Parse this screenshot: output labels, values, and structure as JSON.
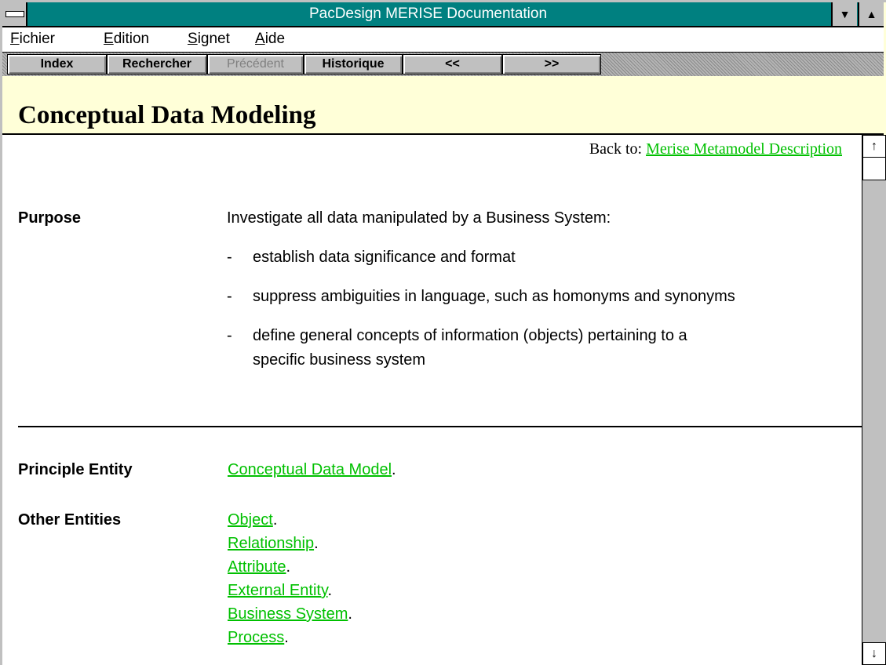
{
  "window": {
    "title": "PacDesign MERISE Documentation",
    "minimize_glyph": "▼",
    "maximize_glyph": "▲"
  },
  "menu": {
    "items": [
      {
        "accel": "F",
        "rest": "ichier"
      },
      {
        "accel": "E",
        "rest": "dition"
      },
      {
        "accel": "S",
        "rest": "ignet"
      },
      {
        "accel": "A",
        "rest": "ide"
      }
    ]
  },
  "toolbar": {
    "index": "Index",
    "search": "Rechercher",
    "previous": "Précédent",
    "history": "Historique",
    "back": "<<",
    "forward": ">>"
  },
  "page": {
    "heading": "Conceptual Data Modeling",
    "back_to_label": "Back to: ",
    "back_to_link": "Merise Metamodel Description",
    "purpose_label": "Purpose",
    "purpose_intro": "Investigate all data manipulated by a Business System:",
    "purpose_points": [
      "establish data significance and format",
      "suppress ambiguities in language, such as homonyms and synonyms",
      "define general concepts of information (objects) pertaining to a",
      "specific business system"
    ],
    "dash": "-",
    "principle_label": "Principle Entity",
    "principle_link": "Conceptual Data Model",
    "other_label": "Other Entities",
    "other_links": [
      "Object",
      "Relationship",
      "Attribute",
      "External Entity",
      "Business System",
      "Process"
    ],
    "period": "."
  },
  "scrollbar": {
    "up_glyph": "↑",
    "down_glyph": "↓"
  },
  "colors": {
    "titlebar": "#008080",
    "link": "#00c000",
    "band": "#ffffd8"
  },
  "icons": [
    "system-menu-icon",
    "minimize-icon",
    "maximize-icon",
    "scroll-up-icon",
    "scroll-down-icon"
  ]
}
